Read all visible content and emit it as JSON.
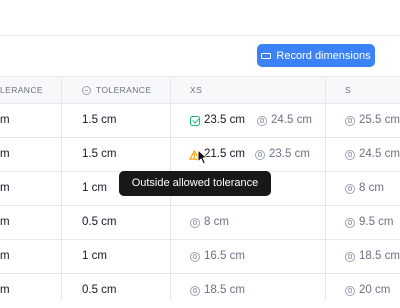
{
  "toolbar": {
    "record_button_label": "Record dimensions"
  },
  "table": {
    "headers": {
      "col1": "LERANCE",
      "col2": "TOLERANCE",
      "col3": "XS",
      "col4": "S"
    },
    "rows": [
      {
        "c1": "m",
        "c2": "1.5 cm",
        "xs_measured": "23.5 cm",
        "xs_status": "ok",
        "xs_target": "24.5 cm",
        "s_target": "25.5 cm"
      },
      {
        "c1": "m",
        "c2": "1.5 cm",
        "xs_measured": "21.5 cm",
        "xs_status": "warning",
        "xs_target": "23.5 cm",
        "s_target": "24.5 cm"
      },
      {
        "c1": "m",
        "c2": "1 cm",
        "xs_target": "",
        "s_target": "8 cm"
      },
      {
        "c1": "m",
        "c2": "0.5 cm",
        "xs_target": "8 cm",
        "s_target": "9.5 cm"
      },
      {
        "c1": "m",
        "c2": "1 cm",
        "xs_target": "16.5 cm",
        "s_target": "18.5 cm"
      },
      {
        "c1": "m",
        "c2": "0.5 cm",
        "xs_target": "18.5 cm",
        "s_target": "20 cm"
      }
    ]
  },
  "tooltip": {
    "text": "Outside allowed tolerance"
  },
  "colors": {
    "accent": "#3b82f6",
    "ok": "#10b981",
    "warning": "#f59e0b",
    "tooltip_bg": "#18181b"
  }
}
